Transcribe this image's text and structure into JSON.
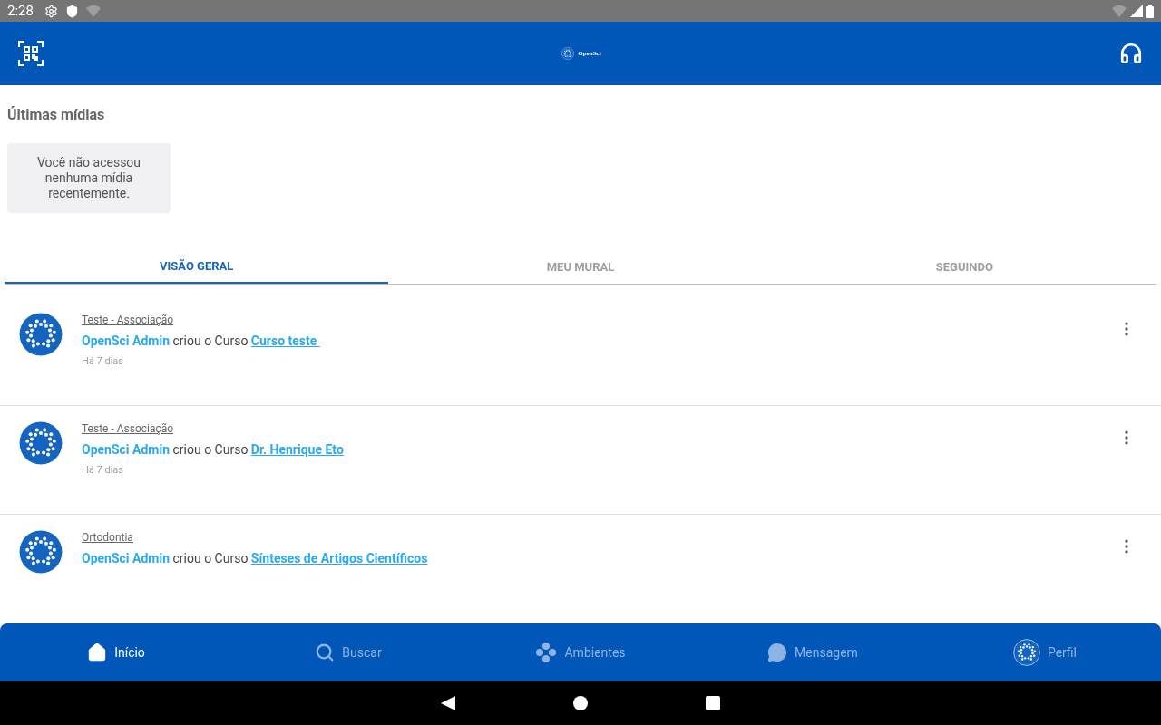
{
  "status_bar": {
    "time": "2:28"
  },
  "header": {
    "logo_text": "OpenSci"
  },
  "recent_media": {
    "title": "Últimas mídias",
    "empty_message": "Você não acessou nenhuma mídia recentemente."
  },
  "tabs": [
    {
      "label": "VISÃO GERAL",
      "selected": true
    },
    {
      "label": "MEU MURAL",
      "selected": false
    },
    {
      "label": "SEGUINDO",
      "selected": false
    }
  ],
  "feed": [
    {
      "category": "Teste - Associação",
      "actor": "OpenSci Admin",
      "action": "criou o Curso",
      "course": "Curso teste ",
      "time": "Há 7 dias"
    },
    {
      "category": "Teste - Associação",
      "actor": "OpenSci Admin",
      "action": "criou o Curso",
      "course": "Dr. Henrique Eto",
      "time": "Há 7 dias"
    },
    {
      "category": "Ortodontia",
      "actor": "OpenSci Admin",
      "action": "criou o Curso",
      "course": "Sínteses de Artigos Científicos"
    }
  ],
  "bottom_nav": [
    {
      "kind": "home",
      "label": "Início",
      "selected": true
    },
    {
      "kind": "search",
      "label": "Buscar",
      "selected": false
    },
    {
      "kind": "environments",
      "label": "Ambientes",
      "selected": false
    },
    {
      "kind": "message",
      "label": "Mensagem",
      "selected": false
    },
    {
      "kind": "profile",
      "label": "Perfil",
      "selected": false
    }
  ]
}
